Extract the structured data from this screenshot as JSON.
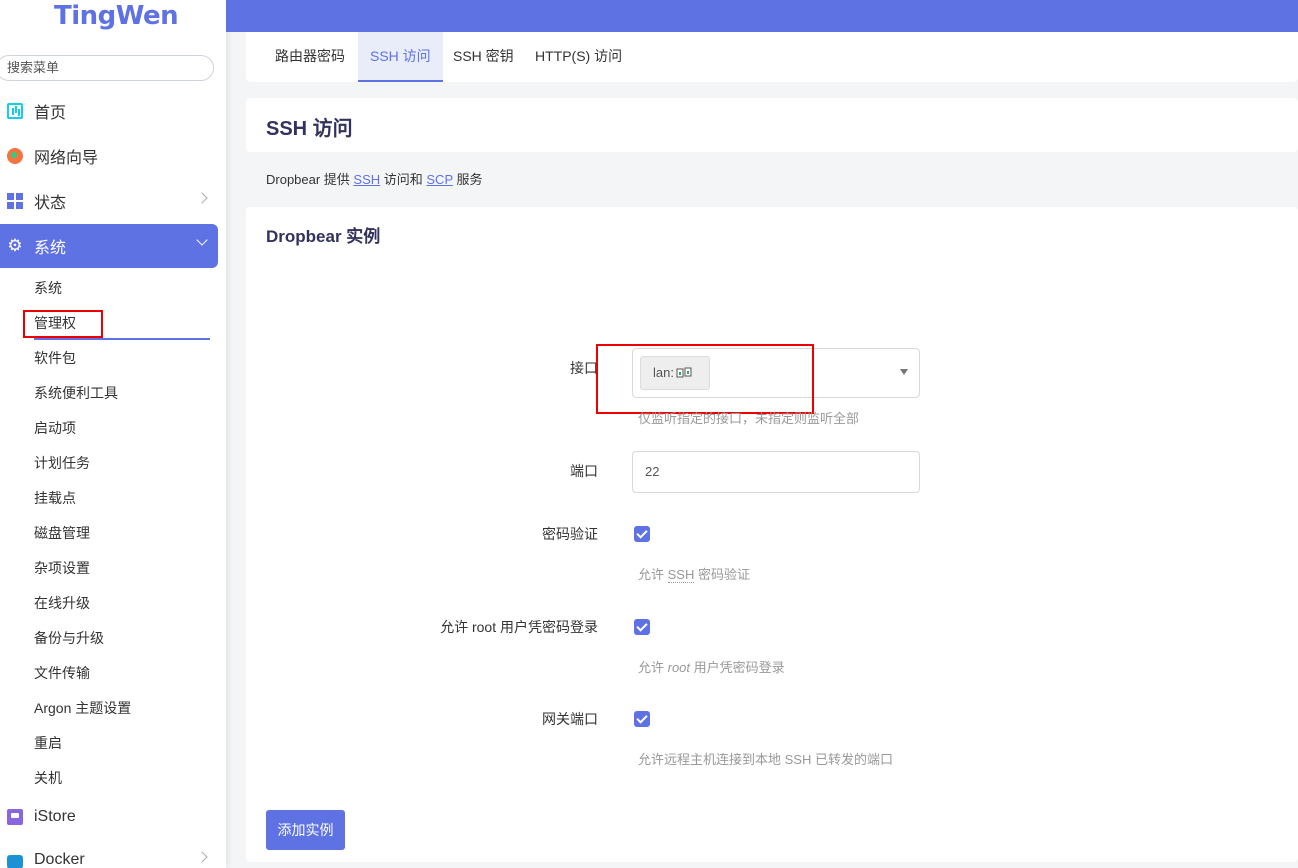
{
  "sidebar": {
    "logo": "TingWen",
    "search_placeholder": "搜索菜单",
    "items": [
      {
        "label": "首页"
      },
      {
        "label": "网络向导"
      },
      {
        "label": "状态"
      },
      {
        "label": "系统"
      },
      {
        "label": "iStore"
      },
      {
        "label": "Docker"
      }
    ],
    "system_subitems": [
      "系统",
      "管理权",
      "软件包",
      "系统便利工具",
      "启动项",
      "计划任务",
      "挂载点",
      "磁盘管理",
      "杂项设置",
      "在线升级",
      "备份与升级",
      "文件传输",
      "Argon 主题设置",
      "重启",
      "关机"
    ]
  },
  "tabs": [
    "路由器密码",
    "SSH 访问",
    "SSH 密钥",
    "HTTP(S) 访问"
  ],
  "page": {
    "title": "SSH 访问",
    "desc_prefix": "Dropbear 提供 ",
    "desc_ssh": "SSH",
    "desc_mid": " 访问和 ",
    "desc_scp": "SCP",
    "desc_suffix": " 服务"
  },
  "section": {
    "title": "Dropbear 实例",
    "interface": {
      "label": "接口",
      "chip": "lan:",
      "hint": "仅监听指定的接口，未指定则监听全部"
    },
    "port": {
      "label": "端口",
      "value": "22"
    },
    "password_auth": {
      "label": "密码验证",
      "hint_prefix": "允许 ",
      "hint_abbr": "SSH",
      "hint_suffix": " 密码验证"
    },
    "root_login": {
      "label": "允许 root 用户凭密码登录",
      "hint_prefix": "允许 ",
      "hint_em": "root",
      "hint_suffix": " 用户凭密码登录"
    },
    "gateway_ports": {
      "label": "网关端口",
      "hint": "允许远程主机连接到本地 SSH 已转发的端口"
    },
    "add_button": "添加实例"
  },
  "colors": {
    "accent": "#5e72e4",
    "highlight": "#e00000"
  }
}
